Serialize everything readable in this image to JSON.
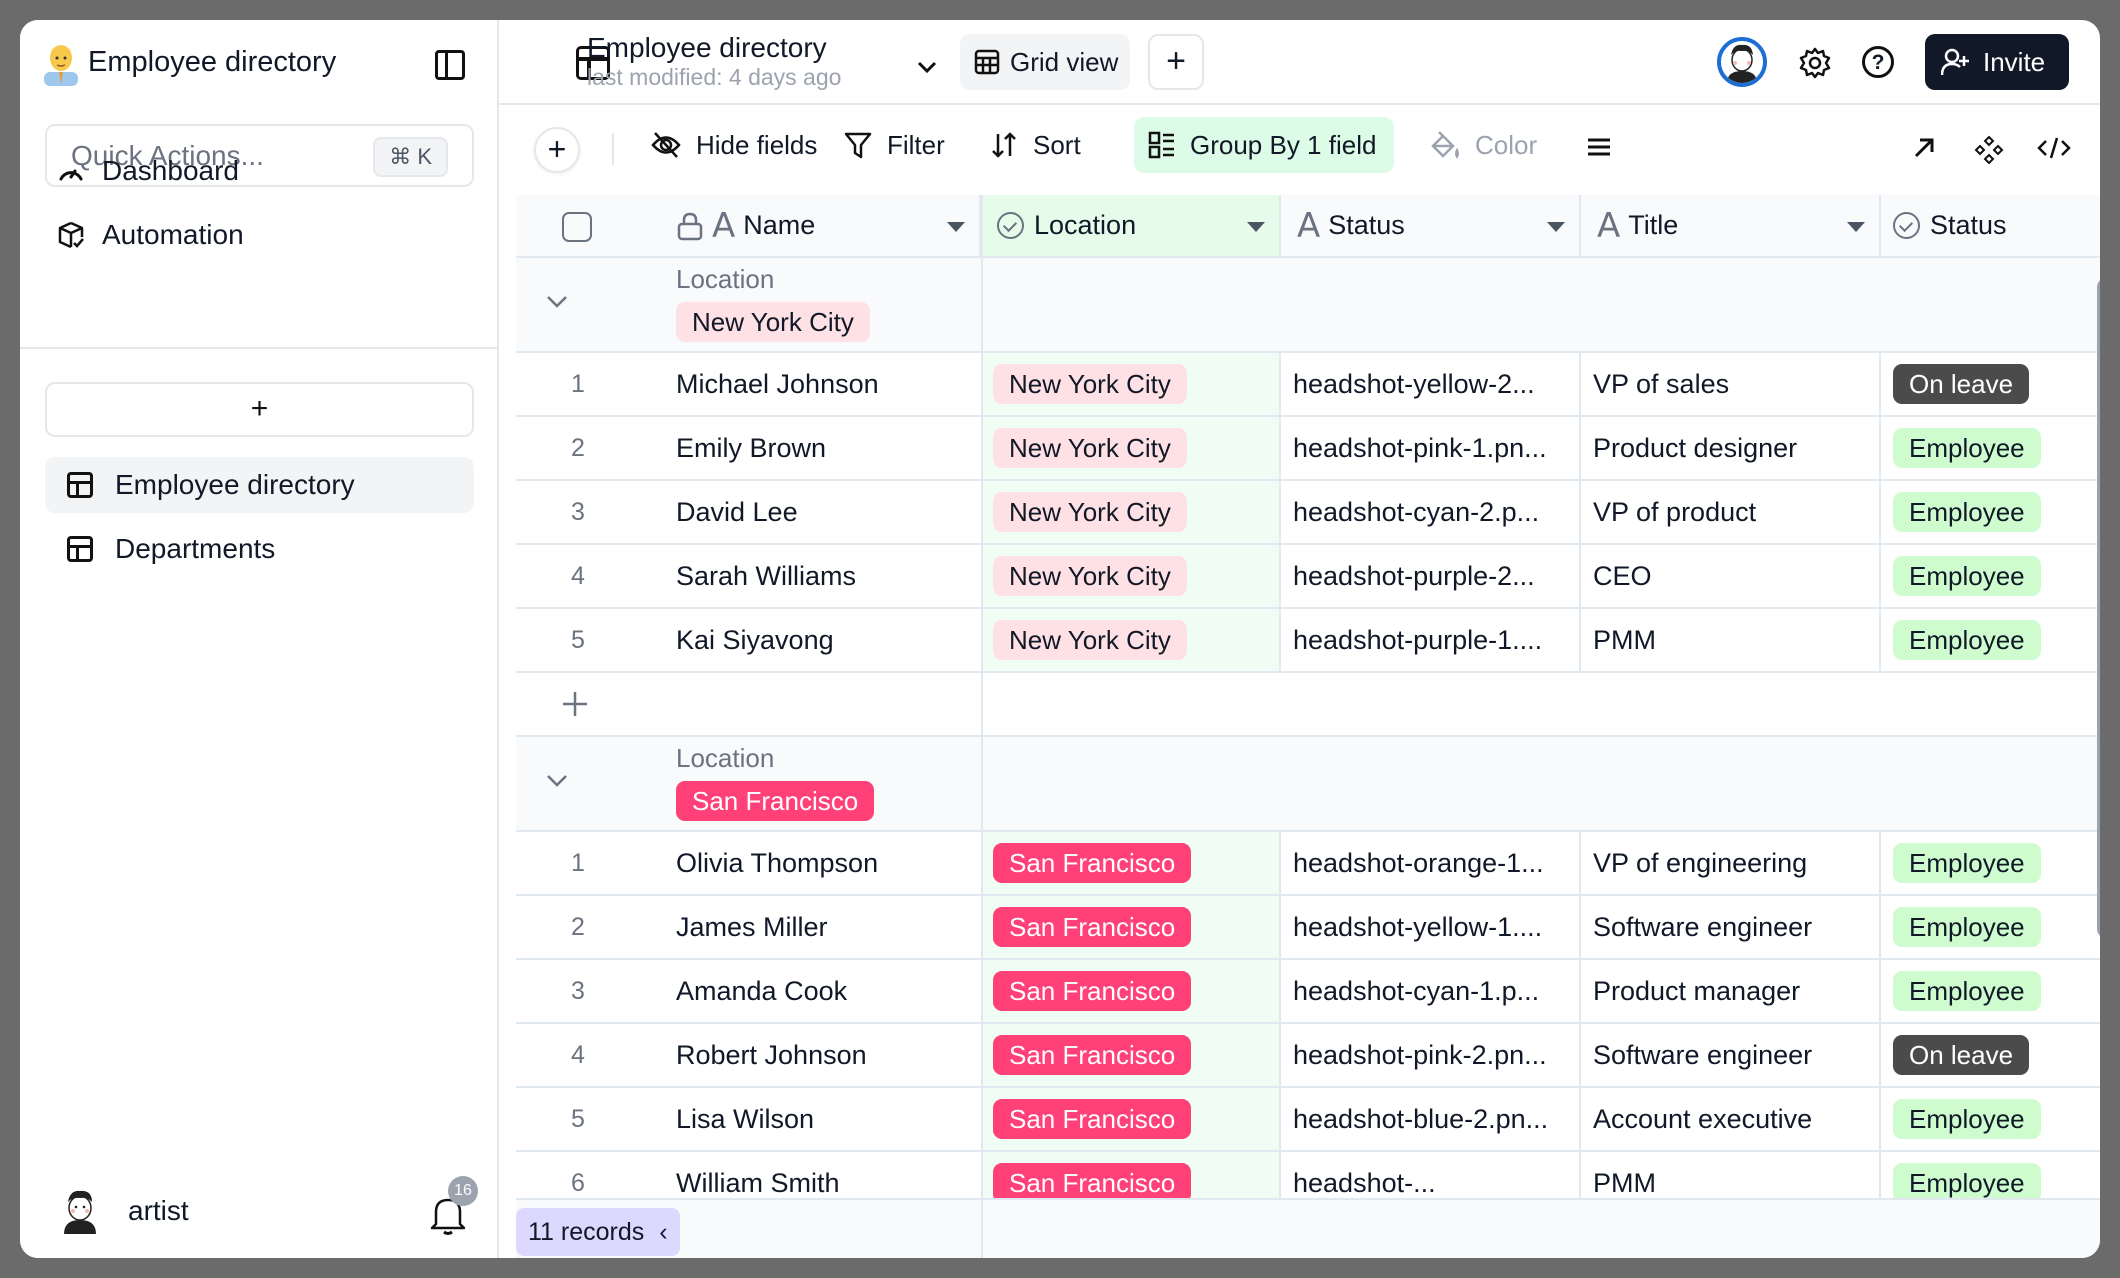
{
  "sidebar": {
    "app_title": "Employee directory",
    "quick_actions_placeholder": "Quick Actions...",
    "quick_actions_shortcut": "⌘ K",
    "nav": [
      {
        "label": "Dashboard",
        "icon": "gauge-icon"
      },
      {
        "label": "Automation",
        "icon": "automation-box-icon"
      }
    ],
    "add_label": "+",
    "tables": [
      {
        "label": "Employee directory",
        "active": true
      },
      {
        "label": "Departments",
        "active": false
      }
    ],
    "user": {
      "name": "artist"
    },
    "notifications_count": "16"
  },
  "header": {
    "title": "Employee directory",
    "subtitle": "last modified: 4 days ago",
    "view_label": "Grid view",
    "add_view_label": "+",
    "invite_label": "Invite"
  },
  "toolbar": {
    "add_label": "+",
    "hide_fields": "Hide fields",
    "filter": "Filter",
    "sort": "Sort",
    "group_by": "Group By 1 field",
    "color": "Color"
  },
  "grid": {
    "columns": [
      {
        "label": "Name",
        "type": "text",
        "locked": true
      },
      {
        "label": "Location",
        "type": "single-select"
      },
      {
        "label": "Status",
        "type": "text"
      },
      {
        "label": "Title",
        "type": "text"
      },
      {
        "label": "Status",
        "type": "single-select"
      }
    ],
    "group_field_label": "Location",
    "groups": [
      {
        "value": "New York City",
        "rows": [
          {
            "num": "1",
            "name": "Michael Johnson",
            "location": "New York City",
            "file": "headshot-yellow-2...",
            "title": "VP of sales",
            "status": "On leave"
          },
          {
            "num": "2",
            "name": "Emily Brown",
            "location": "New York City",
            "file": "headshot-pink-1.pn...",
            "title": "Product designer",
            "status": "Employee"
          },
          {
            "num": "3",
            "name": "David Lee",
            "location": "New York City",
            "file": "headshot-cyan-2.p...",
            "title": "VP of product",
            "status": "Employee"
          },
          {
            "num": "4",
            "name": "Sarah Williams",
            "location": "New York City",
            "file": "headshot-purple-2...",
            "title": "CEO",
            "status": "Employee"
          },
          {
            "num": "5",
            "name": "Kai Siyavong",
            "location": "New York City",
            "file": "headshot-purple-1....",
            "title": "PMM",
            "status": "Employee"
          }
        ]
      },
      {
        "value": "San Francisco",
        "rows": [
          {
            "num": "1",
            "name": "Olivia Thompson",
            "location": "San Francisco",
            "file": "headshot-orange-1...",
            "title": "VP of engineering",
            "status": "Employee"
          },
          {
            "num": "2",
            "name": "James Miller",
            "location": "San Francisco",
            "file": "headshot-yellow-1....",
            "title": "Software engineer",
            "status": "Employee"
          },
          {
            "num": "3",
            "name": "Amanda Cook",
            "location": "San Francisco",
            "file": "headshot-cyan-1.p...",
            "title": "Product manager",
            "status": "Employee"
          },
          {
            "num": "4",
            "name": "Robert Johnson",
            "location": "San Francisco",
            "file": "headshot-pink-2.pn...",
            "title": "Software engineer",
            "status": "On leave"
          },
          {
            "num": "5",
            "name": "Lisa Wilson",
            "location": "San Francisco",
            "file": "headshot-blue-2.pn...",
            "title": "Account executive",
            "status": "Employee"
          },
          {
            "num": "6",
            "name": "William Smith",
            "location": "San Francisco",
            "file": "headshot-...",
            "title": "PMM",
            "status": "Employee"
          }
        ]
      }
    ],
    "records_label": "11 records",
    "records_collapse": "‹"
  },
  "colors": {
    "accent_group_by": "#dcfce7",
    "tag_nyc": "#fde1e4",
    "tag_sf": "#ff4178",
    "tag_employee": "#cffccf",
    "tag_on_leave": "#4b4b4b",
    "invite_button": "#111827",
    "records_badge": "#ddd8fe"
  }
}
